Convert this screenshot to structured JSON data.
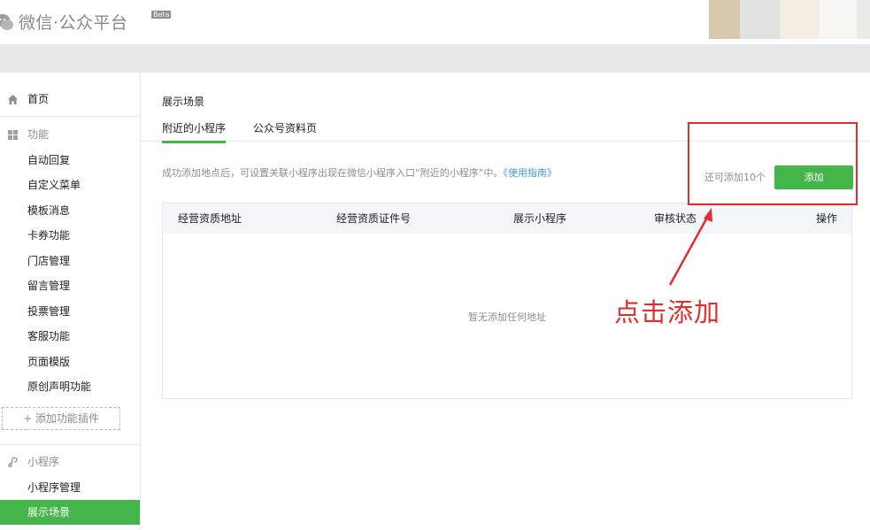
{
  "header": {
    "app_title": "微信·公众平台",
    "beta_badge": "Beta",
    "avatar_colors": [
      "#d8c9ae",
      "#e0e2df",
      "#f3eee1",
      "#f7f6f3",
      "#eceae7"
    ]
  },
  "sidebar": {
    "home": {
      "icon": "home-icon",
      "label": "首页"
    },
    "functions": {
      "icon": "grid-icon",
      "label": "功能",
      "items": [
        "自动回复",
        "自定义菜单",
        "模板消息",
        "卡券功能",
        "门店管理",
        "留言管理",
        "投票管理",
        "客服功能",
        "页面模版",
        "原创声明功能"
      ]
    },
    "add_plugin_label": "+ 添加功能插件",
    "miniprogram": {
      "icon": "miniprogram-icon",
      "label": "小程序",
      "items": [
        "小程序管理",
        "展示场景"
      ],
      "active_item": "展示场景"
    },
    "colors": {
      "active_bg": "#44b549"
    }
  },
  "main": {
    "title": "展示场景",
    "tabs": [
      {
        "label": "附近的小程序",
        "active": true
      },
      {
        "label": "公众号资料页",
        "active": false
      }
    ],
    "tip_text": "成功添加地点后，可设置关联小程序出现在微信小程序入口“附近的小程序”中。",
    "tip_link": "《使用指南》",
    "quota_text": "还可添加10个",
    "add_button": "添加",
    "table": {
      "columns": [
        "经营资质地址",
        "经营资质证件号",
        "展示小程序",
        "审核状态",
        "操作"
      ],
      "empty_text": "暂无添加任何地址"
    }
  },
  "annotation": {
    "text": "点击添加",
    "color": "#e02e2e"
  }
}
